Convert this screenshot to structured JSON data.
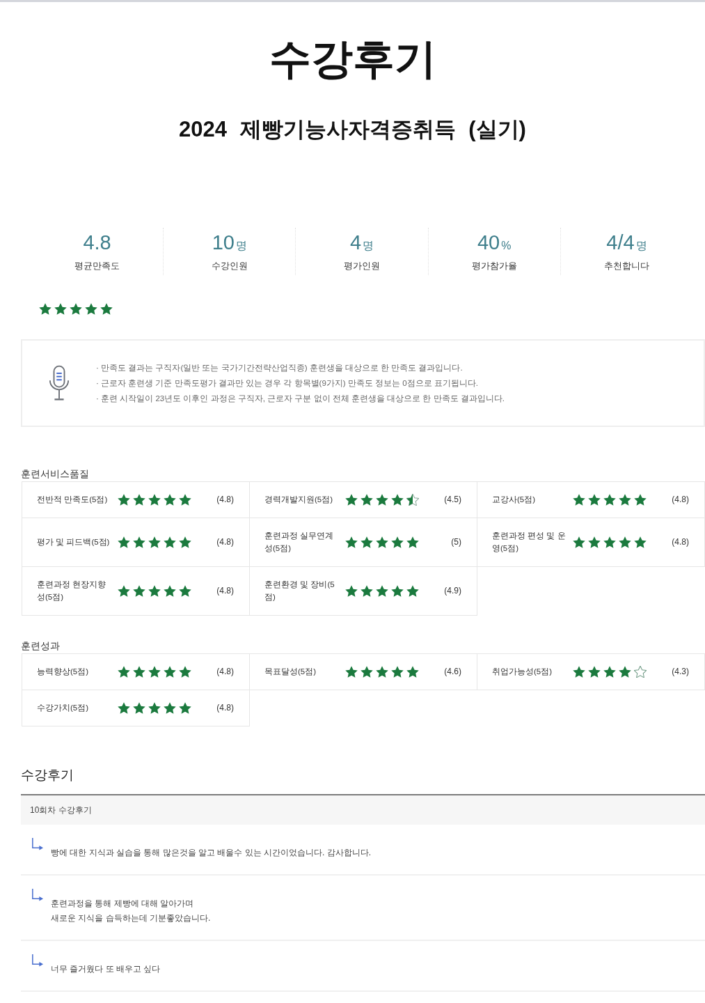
{
  "page": {
    "title": "수강후기",
    "course": "2024 제빵기능사자격증취득 (실기)"
  },
  "summary": {
    "stats": [
      {
        "value": "4.8",
        "label": "평균만족도"
      },
      {
        "value": "10",
        "unit": "명",
        "label": "수강인원"
      },
      {
        "value": "4",
        "unit": "명",
        "label": "평가인원"
      },
      {
        "value": "40",
        "unit": "%",
        "label": "평가참가율"
      },
      {
        "value": "4/4",
        "unit": "명",
        "label": "추천합니다"
      }
    ],
    "stars": 5
  },
  "notice": {
    "lines": [
      "· 만족도 결과는 구직자(일반 또는 국가기간전략산업직종) 훈련생을 대상으로 한 만족도 결과입니다.",
      "· 근로자 훈련생 기준 만족도평가 결과만 있는 경우 각 항목별(9가지) 만족도 정보는 0점으로 표기됩니다.",
      "· 훈련 시작일이 23년도 이후인 과정은 구직자, 근로자 구분 없이 전체 훈련생을 대상으로 한 만족도 결과입니다."
    ]
  },
  "quality": {
    "title": "훈련서비스품질",
    "items": [
      {
        "label": "전반적 만족도(5점)",
        "stars": 5,
        "score": "(4.8)"
      },
      {
        "label": "경력개발지원(5점)",
        "stars": 4.5,
        "score": "(4.5)"
      },
      {
        "label": "교강사(5점)",
        "stars": 5,
        "score": "(4.8)"
      },
      {
        "label": "평가 및 피드백(5점)",
        "stars": 5,
        "score": "(4.8)"
      },
      {
        "label": "훈련과정 실무연계성(5점)",
        "stars": 5,
        "score": "(5)"
      },
      {
        "label": "훈련과정 편성 및 운영(5점)",
        "stars": 5,
        "score": "(4.8)"
      },
      {
        "label": "훈련과정 현장지향성(5점)",
        "stars": 5,
        "score": "(4.8)"
      },
      {
        "label": "훈련환경 및 장비(5점)",
        "stars": 5,
        "score": "(4.9)"
      }
    ]
  },
  "outcomes": {
    "title": "훈련성과",
    "items": [
      {
        "label": "능력향상(5점)",
        "stars": 5,
        "score": "(4.8)"
      },
      {
        "label": "목표달성(5점)",
        "stars": 5,
        "score": "(4.6)"
      },
      {
        "label": "취업가능성(5점)",
        "stars": 4,
        "score": "(4.3)"
      },
      {
        "label": "수강가치(5점)",
        "stars": 5,
        "score": "(4.8)"
      }
    ]
  },
  "reviews": {
    "title": "수강후기",
    "header": "10회차 수강후기",
    "rows": [
      {
        "text": "빵에 대한 지식과 실습을 통해 많은것을 알고 배울수 있는 시간이었습니다. 감사합니다."
      },
      {
        "text": "훈련과정을 통해 제빵에 대해 알아가며\n새로운 지식을 습득하는데 기분좋았습니다."
      },
      {
        "text": "너무 즐거웠다 또 배우고 싶다"
      }
    ]
  }
}
